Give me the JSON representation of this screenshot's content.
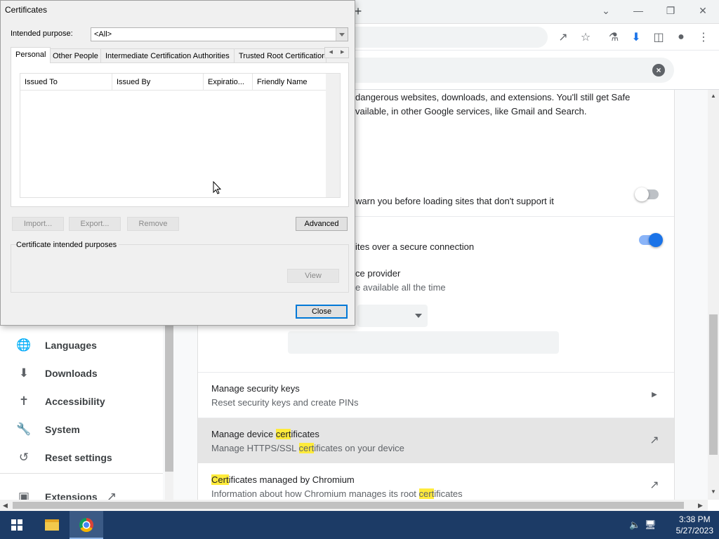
{
  "dialog": {
    "title": "Certificates",
    "purpose_label": "Intended purpose:",
    "purpose_value": "<All>",
    "tabs": [
      {
        "label": "Personal"
      },
      {
        "label": "Other People"
      },
      {
        "label": "Intermediate Certification Authorities"
      },
      {
        "label": "Trusted Root Certification"
      }
    ],
    "columns": [
      "Issued To",
      "Issued By",
      "Expiratio...",
      "Friendly Name"
    ],
    "buttons": {
      "import": "Import...",
      "export": "Export...",
      "remove": "Remove",
      "advanced": "Advanced",
      "view": "View",
      "close": "Close"
    },
    "purposes_group_label": "Certificate intended purposes"
  },
  "settings": {
    "safe_browsing_text_1": "dangerous websites, downloads, and extensions. You'll still get Safe",
    "safe_browsing_text_2": "vailable, in other Google services, like Gmail and Search.",
    "https_warn_text": "warn you before loading sites that don't support it",
    "secure_dns_text": "ites over a secure connection",
    "provider_title": "ce provider",
    "provider_sub": "e available all the time",
    "rows": {
      "security_keys_title": "Manage security keys",
      "security_keys_sub": "Reset security keys and create PINs",
      "device_certs_title_pre": "Manage device ",
      "device_certs_title_hl": "cert",
      "device_certs_title_post": "ificates",
      "device_certs_sub_pre": "Manage HTTPS/SSL ",
      "device_certs_sub_hl": "cert",
      "device_certs_sub_post": "ificates on your device",
      "chromium_certs_title_hl": "Cert",
      "chromium_certs_title_post": "ificates managed by Chromium",
      "chromium_certs_sub_pre": "Information about how Chromium manages its root ",
      "chromium_certs_sub_hl": "cert",
      "chromium_certs_sub_post": "ificates"
    },
    "toggles": {
      "https_first": false,
      "secure_dns": true
    }
  },
  "sidebar": {
    "items": [
      {
        "label": "Languages",
        "icon": "globe-icon"
      },
      {
        "label": "Downloads",
        "icon": "download-icon"
      },
      {
        "label": "Accessibility",
        "icon": "accessibility-icon"
      },
      {
        "label": "System",
        "icon": "wrench-icon"
      },
      {
        "label": "Reset settings",
        "icon": "reset-icon"
      },
      {
        "label": "Extensions",
        "icon": "puzzle-icon"
      }
    ]
  },
  "taskbar": {
    "time": "3:38 PM",
    "date": "5/27/2023"
  },
  "colors": {
    "accent_blue": "#1a73e8",
    "highlight": "#ffeb3b",
    "taskbar": "#1c3b66",
    "recording_dot": "#e8204a"
  }
}
